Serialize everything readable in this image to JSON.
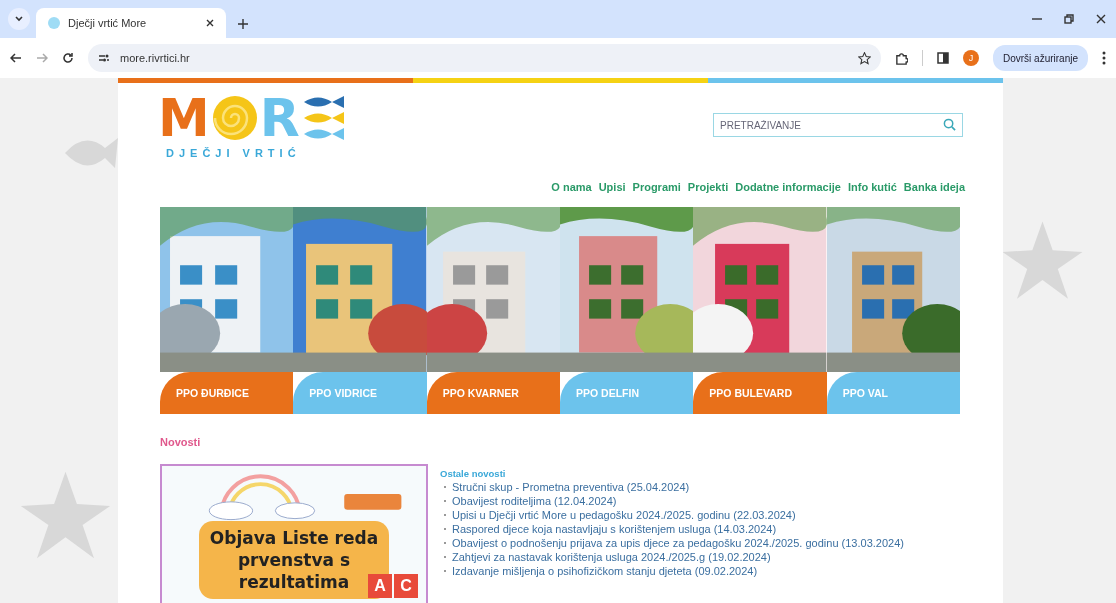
{
  "browser": {
    "tabs": [
      {
        "title": "Dječji vrtić More",
        "selected": true
      }
    ],
    "url": "more.rivrtici.hr",
    "profile_initial": "J",
    "update_button": "Dovrši ažuriranje"
  },
  "site": {
    "logo": {
      "letters": [
        "M",
        "R"
      ],
      "subtitle": "DJEČJI VRTIĆ"
    },
    "search": {
      "placeholder": "PRETRAŽIVANJE"
    },
    "nav": [
      "O nama",
      "Upisi",
      "Programi",
      "Projekti",
      "Dodatne informacije",
      "Info kutić",
      "Banka ideja"
    ],
    "locations": [
      {
        "label": "PPO ĐURĐICE",
        "color": "#e8701a"
      },
      {
        "label": "PPO VIDRICE",
        "color": "#6cc3ec"
      },
      {
        "label": "PPO KVARNER",
        "color": "#e8701a"
      },
      {
        "label": "PPO DELFIN",
        "color": "#6cc3ec"
      },
      {
        "label": "PPO BULEVARD",
        "color": "#e8701a"
      },
      {
        "label": "PPO VAL",
        "color": "#6cc3ec"
      }
    ],
    "news_heading": "Novosti",
    "poster": {
      "headline": "Objava Liste reda prvenstva s rezultatima",
      "letters": [
        "A",
        "C"
      ]
    },
    "other_news": {
      "heading": "Ostale novosti",
      "items": [
        "Stručni skup - Prometna preventiva (25.04.2024)",
        "Obavijest roditeljima (12.04.2024)",
        "Upisi u Dječji vrtić More u pedagošku 2024./2025. godinu (22.03.2024)",
        "Raspored djece koja nastavljaju s korištenjem usluga (14.03.2024)",
        "Obavijest o podnošenju prijava za upis djece za pedagošku 2024./2025. godinu (13.03.2024)",
        "Zahtjevi za nastavak korištenja usluga 2024./2025.g (19.02.2024)",
        "Izdavanje mišljenja o psihofizičkom stanju djeteta (09.02.2024)"
      ]
    }
  }
}
